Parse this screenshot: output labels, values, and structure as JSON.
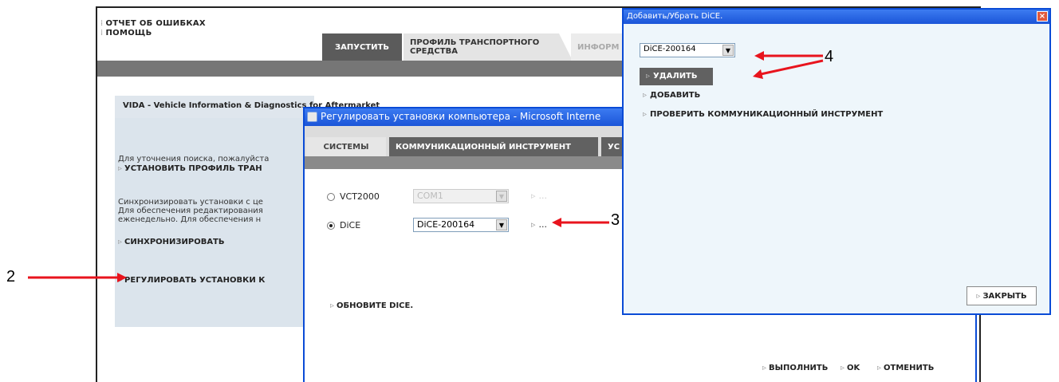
{
  "app": {
    "menu_report": "ОТЧЕТ ОБ ОШИБКАХ",
    "menu_help": "ПОМОЩЬ",
    "tab_run": "ЗАПУСТИТЬ",
    "tab_profile_line1": "ПРОФИЛЬ ТРАНСПОРТНОГО",
    "tab_profile_line2": "СРЕДСТВА",
    "tab_info": "ИНФОРМ",
    "vida_header": "VIDA - Vehicle Information & Dia",
    "vida_header_tail": "gnostics for Aftermarket",
    "panel_text1": "Для уточнения поиска, пожалуйста",
    "panel_link_profile": "УСТАНОВИТЬ ПРОФИЛЬ ТРАН",
    "panel_text2a": "Синхронизировать установки с це",
    "panel_text2b": "Для обеспечения редактирования",
    "panel_text2c": "еженедельно. Для обеспечения н",
    "panel_link_sync": "СИНХРОНИЗИРОВАТЬ",
    "panel_link_adjust": "РЕГУЛИРОВАТЬ УСТАНОВКИ К"
  },
  "mid_dialog": {
    "title": "Регулировать установки компьютера - Microsoft Interne",
    "tab_systems": "СИСТЕМЫ",
    "tab_comm": "КОММУНИКАЦИОННЫЙ ИНСТРУМЕНТ",
    "tab_next": "УС",
    "radio_vct": "VCT2000",
    "select_vct": "COM1",
    "radio_dice": "DiCE",
    "select_dice": "DiCE-200164",
    "ellipsis": "...",
    "link_update": "ОБНОВИТЕ DICE.",
    "btn_apply": "ВЫПОЛНИТЬ",
    "btn_ok": "OK",
    "btn_cancel": "ОТМЕНИТЬ"
  },
  "right_dialog": {
    "title": "Добавить/Убрать DiCE.",
    "select_value": "DiCE-200164",
    "btn_delete": "УДАЛИТЬ",
    "link_add": "ДОБАВИТЬ",
    "link_check": "ПРОВЕРИТЬ КОММУНИКАЦИОННЫЙ ИНСТРУМЕНТ",
    "btn_close": "ЗАКРЫТЬ"
  },
  "annotations": {
    "n2": "2",
    "n3": "3",
    "n4": "4"
  },
  "colors": {
    "accent_tab": "#5b5b5b",
    "xp_title": "#1b55d8",
    "annotation_arrow": "#e8141d"
  }
}
